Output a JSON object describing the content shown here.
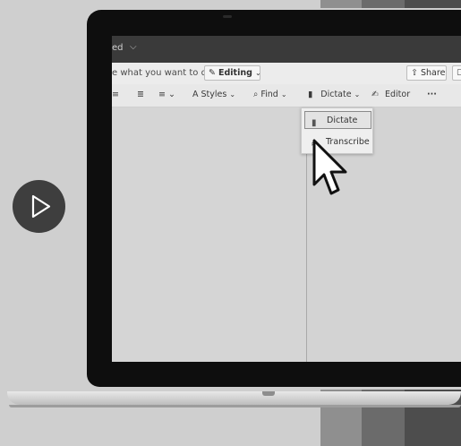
{
  "colors": {
    "background": "#cfcfcf",
    "bezel": "#0e0e0e",
    "titlebar": "#3a3a3a",
    "play_button": "#3e3e3e"
  },
  "word_app": {
    "title_fragment": "ed",
    "tell_me_text": "e what you want to do",
    "editing_label": "Editing",
    "share_label": "Share",
    "ribbon": {
      "styles_label": "Styles",
      "find_label": "Find",
      "dictate_label": "Dictate",
      "editor_label": "Editor",
      "more_label": "···"
    },
    "dictate_dropdown": {
      "items": [
        {
          "label": "Dictate",
          "icon": "microphone-icon",
          "selected": true
        },
        {
          "label": "Transcribe",
          "icon": "transcribe-icon",
          "selected": false
        }
      ]
    }
  },
  "video": {
    "play_icon": "play-icon"
  }
}
